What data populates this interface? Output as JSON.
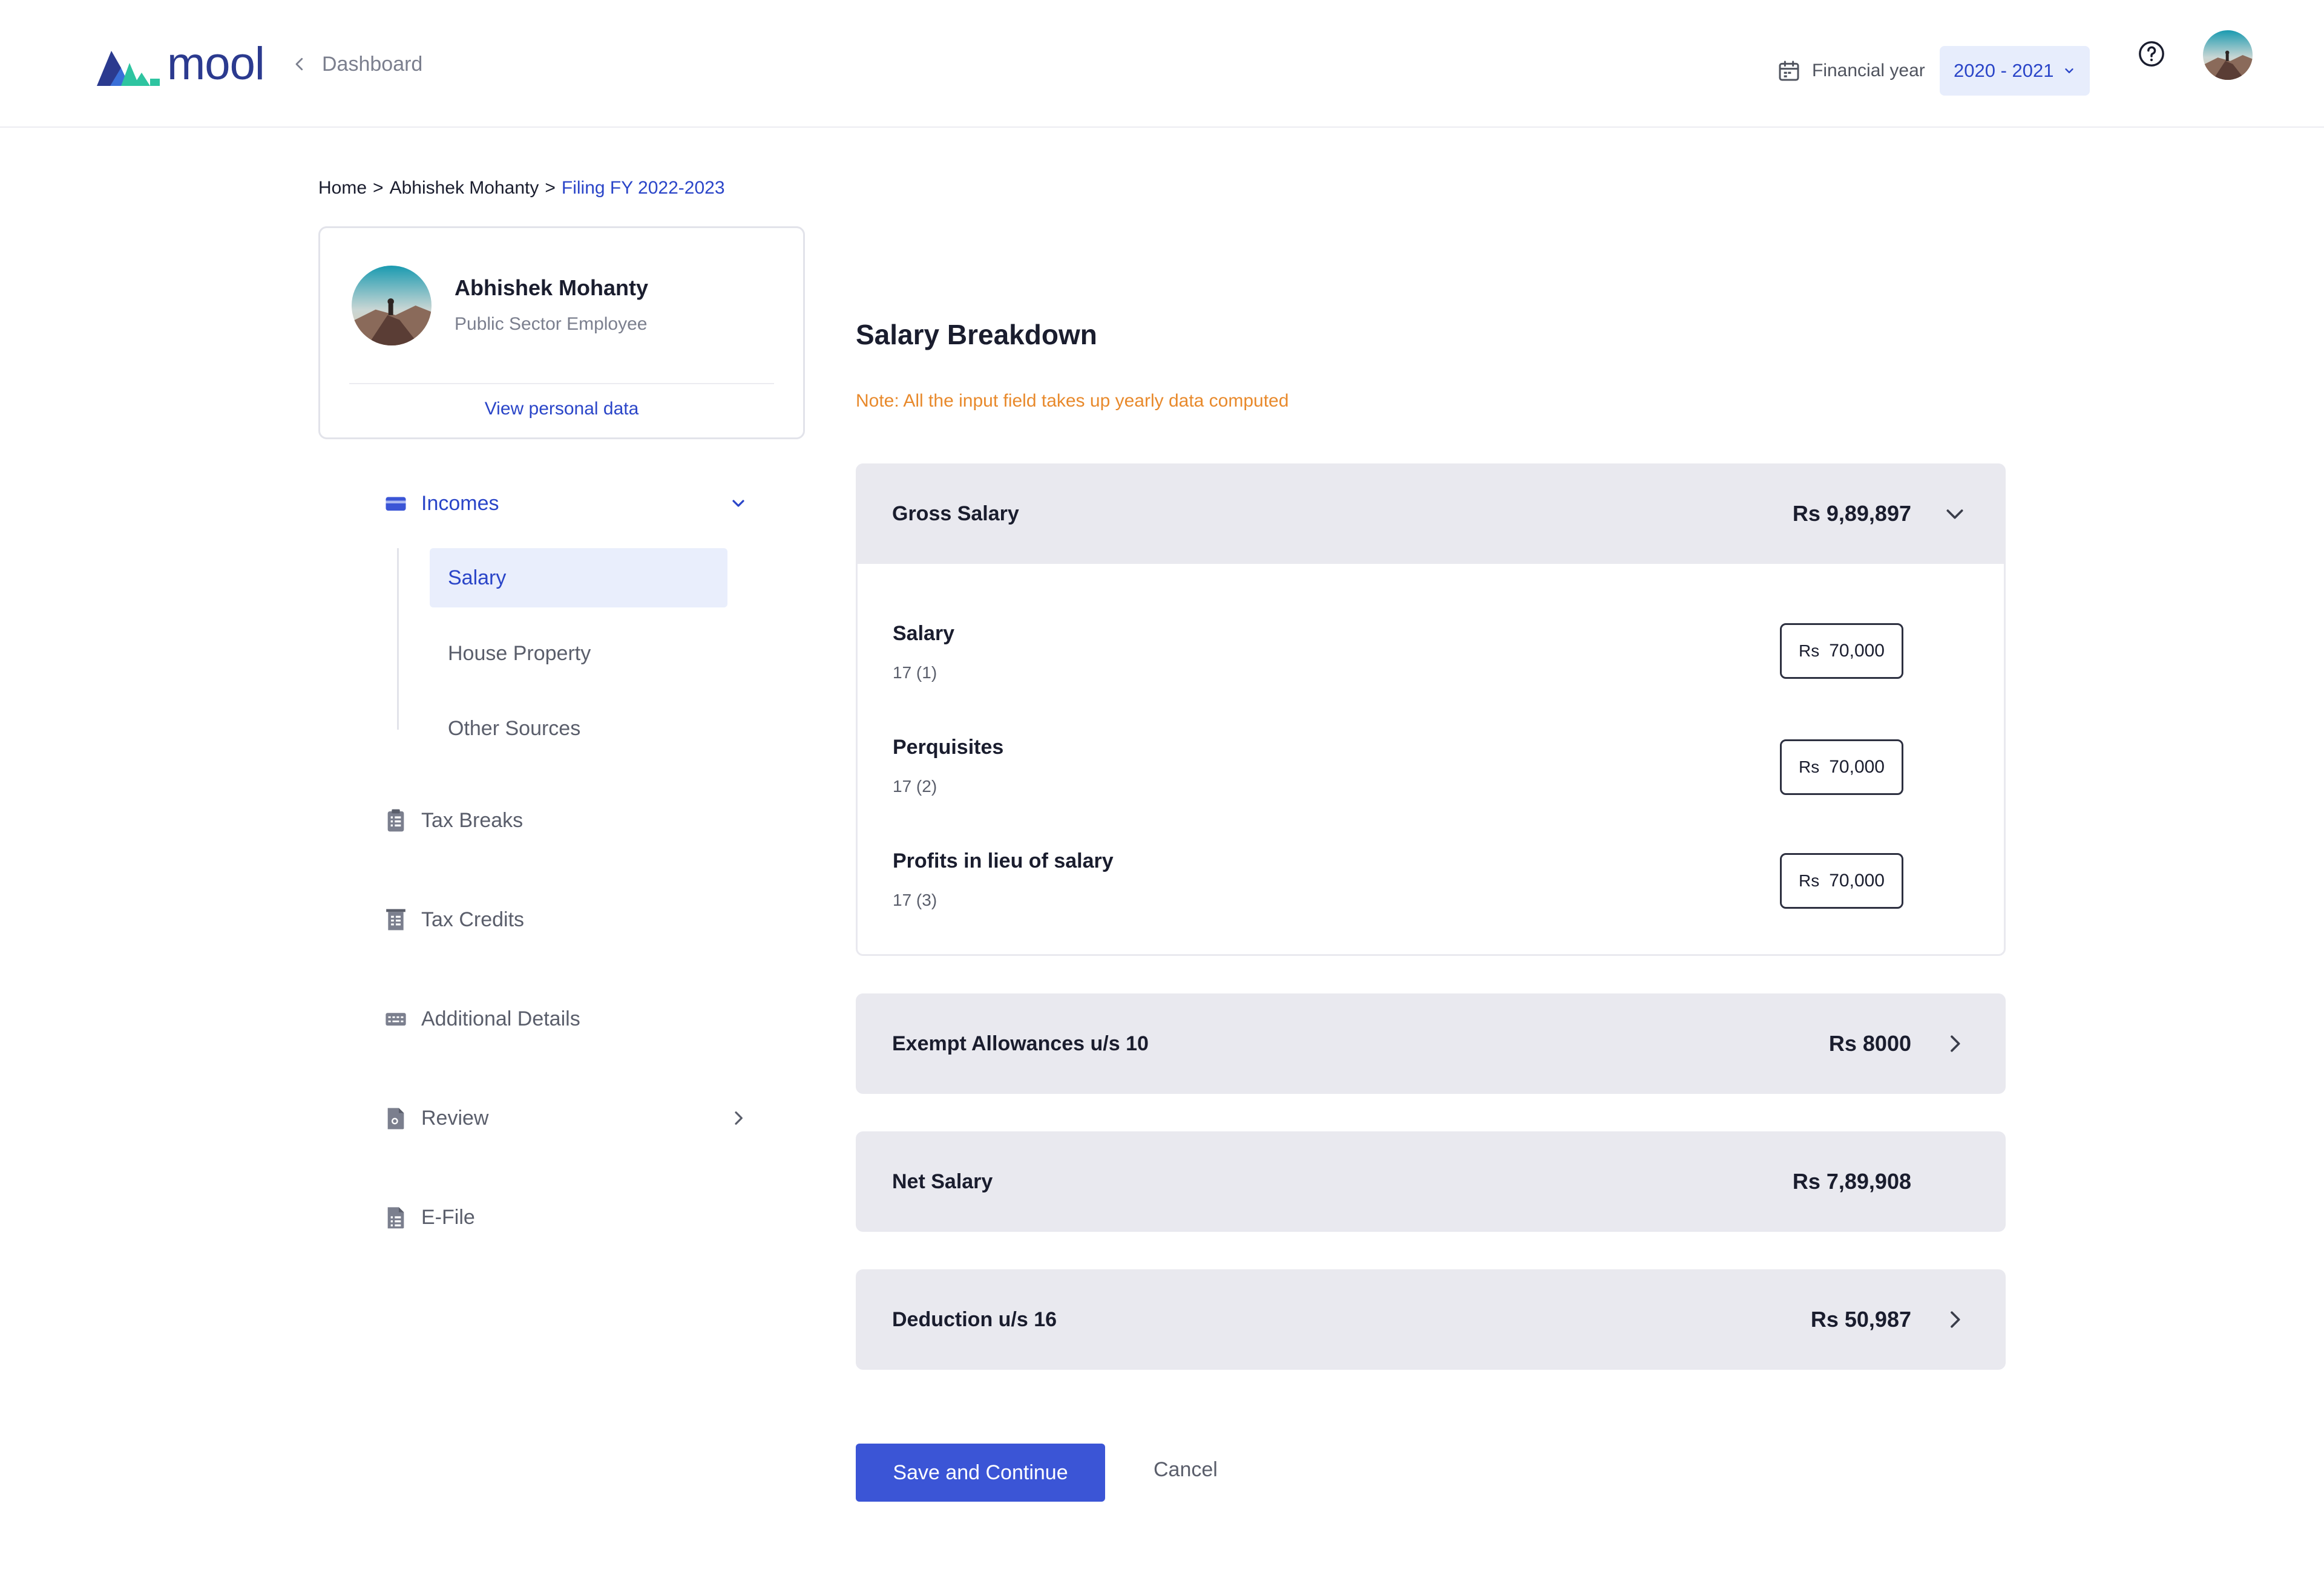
{
  "header": {
    "logo_text": "mool",
    "back_label": "Dashboard",
    "financial_year_label": "Financial year",
    "financial_year_value": "2020 - 2021"
  },
  "breadcrumb": {
    "home": "Home",
    "separator_1": ">",
    "person": "Abhishek Mohanty",
    "separator_2": ">",
    "current": "Filing FY 2022-2023"
  },
  "profile": {
    "name": "Abhishek Mohanty",
    "role": "Public Sector Employee",
    "link": "View personal data"
  },
  "sidebar": {
    "incomes": "Incomes",
    "sub_items": [
      "Salary",
      "House Property",
      "Other Sources"
    ],
    "tax_breaks": "Tax Breaks",
    "tax_credits": "Tax Credits",
    "additional_details": "Additional Details",
    "review": "Review",
    "efile": "E-File"
  },
  "main": {
    "title": "Salary Breakdown",
    "note": "Note: All the input field takes up yearly data computed",
    "gross": {
      "label": "Gross Salary",
      "amount": "Rs 9,89,897",
      "rows": [
        {
          "label": "Salary",
          "section": "17 (1)",
          "currency": "Rs",
          "value": "70,000"
        },
        {
          "label": "Perquisites",
          "section": "17 (2)",
          "currency": "Rs",
          "value": "70,000"
        },
        {
          "label": "Profits in lieu of salary",
          "section": "17 (3)",
          "currency": "Rs",
          "value": "70,000"
        }
      ]
    },
    "exempt": {
      "label": "Exempt Allowances u/s 10",
      "amount": "Rs 8000"
    },
    "net": {
      "label": "Net Salary",
      "amount": "Rs 7,89,908"
    },
    "deduction": {
      "label": "Deduction u/s 16",
      "amount": "Rs 50,987"
    }
  },
  "actions": {
    "save": "Save and Continue",
    "cancel": "Cancel"
  },
  "colors": {
    "accent": "#3b55d6",
    "link": "#2a45c8",
    "note": "#e8892b",
    "panel": "#e9e9ef",
    "logo_teal": "#2ec4a0",
    "logo_blue": "#2b3a8f"
  }
}
